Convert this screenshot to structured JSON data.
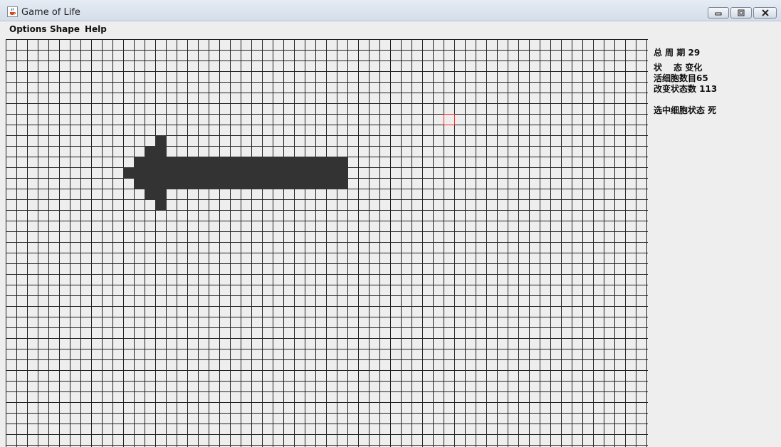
{
  "window": {
    "title": "Game of Life",
    "icon": "java-cup-icon",
    "controls": {
      "minimize_icon": "minimize-icon",
      "maximize_icon": "maximize-icon",
      "close_icon": "close-icon"
    }
  },
  "menu": {
    "items": [
      "Options",
      "Shape",
      "Help"
    ]
  },
  "grid": {
    "cell_color": "#333333",
    "gridline_color": "#1f1f1f",
    "background_color": "#eeeeee",
    "selected_outline_color": "#ff2020",
    "live_cells": [
      [
        14,
        9
      ],
      [
        13,
        10
      ],
      [
        14,
        10
      ],
      [
        12,
        11
      ],
      [
        13,
        11
      ],
      [
        14,
        11
      ],
      [
        15,
        11
      ],
      [
        16,
        11
      ],
      [
        17,
        11
      ],
      [
        18,
        11
      ],
      [
        19,
        11
      ],
      [
        20,
        11
      ],
      [
        21,
        11
      ],
      [
        22,
        11
      ],
      [
        23,
        11
      ],
      [
        24,
        11
      ],
      [
        25,
        11
      ],
      [
        26,
        11
      ],
      [
        27,
        11
      ],
      [
        28,
        11
      ],
      [
        29,
        11
      ],
      [
        30,
        11
      ],
      [
        31,
        11
      ],
      [
        11,
        12
      ],
      [
        12,
        12
      ],
      [
        13,
        12
      ],
      [
        14,
        12
      ],
      [
        15,
        12
      ],
      [
        16,
        12
      ],
      [
        17,
        12
      ],
      [
        18,
        12
      ],
      [
        19,
        12
      ],
      [
        20,
        12
      ],
      [
        21,
        12
      ],
      [
        22,
        12
      ],
      [
        23,
        12
      ],
      [
        24,
        12
      ],
      [
        25,
        12
      ],
      [
        26,
        12
      ],
      [
        27,
        12
      ],
      [
        28,
        12
      ],
      [
        29,
        12
      ],
      [
        30,
        12
      ],
      [
        31,
        12
      ],
      [
        12,
        13
      ],
      [
        13,
        13
      ],
      [
        14,
        13
      ],
      [
        15,
        13
      ],
      [
        16,
        13
      ],
      [
        17,
        13
      ],
      [
        18,
        13
      ],
      [
        19,
        13
      ],
      [
        20,
        13
      ],
      [
        21,
        13
      ],
      [
        22,
        13
      ],
      [
        23,
        13
      ],
      [
        24,
        13
      ],
      [
        25,
        13
      ],
      [
        26,
        13
      ],
      [
        27,
        13
      ],
      [
        28,
        13
      ],
      [
        29,
        13
      ],
      [
        30,
        13
      ],
      [
        31,
        13
      ],
      [
        13,
        14
      ],
      [
        14,
        14
      ],
      [
        14,
        15
      ]
    ],
    "selected_cell": [
      41,
      7
    ]
  },
  "stats": {
    "generation_label": "总 周 期",
    "generation_value": "29",
    "state_label": "状　 态",
    "state_value": "变化",
    "alive_label": "活细胞数目",
    "alive_value": "65",
    "changed_label": "改变状态数",
    "changed_value": "113",
    "selected_label": "选中细胞状态",
    "selected_value": "死"
  }
}
